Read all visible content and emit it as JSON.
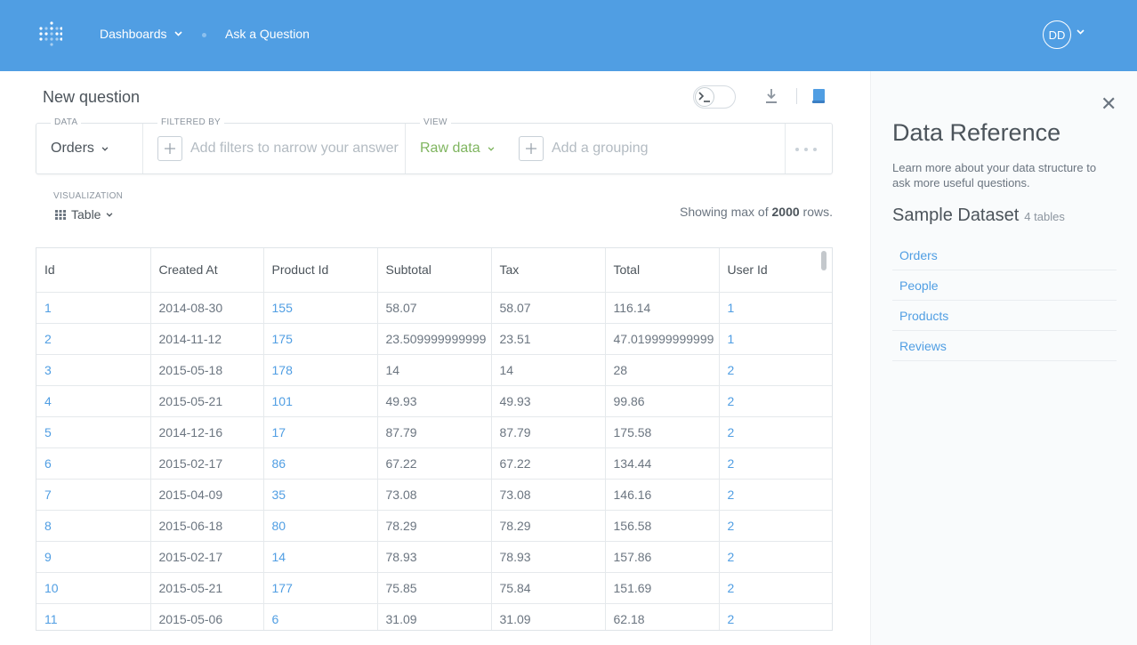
{
  "nav": {
    "dashboards_label": "Dashboards",
    "ask_label": "Ask a Question",
    "avatar_initials": "DD",
    "accent_color": "#509ee3"
  },
  "question": {
    "title": "New question"
  },
  "query_builder": {
    "data_label": "DATA",
    "data_value": "Orders",
    "filter_label": "FILTERED BY",
    "filter_placeholder": "Add filters to narrow your answer",
    "view_label": "VIEW",
    "view_value": "Raw data",
    "grouping_placeholder": "Add a grouping"
  },
  "visualization": {
    "label": "VISUALIZATION",
    "value": "Table"
  },
  "rows_note": {
    "prefix": "Showing max of",
    "count": "2000",
    "suffix": "rows."
  },
  "table": {
    "columns": [
      "Id",
      "Created At",
      "Product Id",
      "Subtotal",
      "Tax",
      "Total",
      "User Id"
    ],
    "rows": [
      [
        "1",
        "2014-08-30",
        "155",
        "58.07",
        "58.07",
        "116.14",
        "1"
      ],
      [
        "2",
        "2014-11-12",
        "175",
        "23.509999999999",
        "23.51",
        "47.019999999999",
        "1"
      ],
      [
        "3",
        "2015-05-18",
        "178",
        "14",
        "14",
        "28",
        "2"
      ],
      [
        "4",
        "2015-05-21",
        "101",
        "49.93",
        "49.93",
        "99.86",
        "2"
      ],
      [
        "5",
        "2014-12-16",
        "17",
        "87.79",
        "87.79",
        "175.58",
        "2"
      ],
      [
        "6",
        "2015-02-17",
        "86",
        "67.22",
        "67.22",
        "134.44",
        "2"
      ],
      [
        "7",
        "2015-04-09",
        "35",
        "73.08",
        "73.08",
        "146.16",
        "2"
      ],
      [
        "8",
        "2015-06-18",
        "80",
        "78.29",
        "78.29",
        "156.58",
        "2"
      ],
      [
        "9",
        "2015-02-17",
        "14",
        "78.93",
        "78.93",
        "157.86",
        "2"
      ],
      [
        "10",
        "2015-05-21",
        "177",
        "75.85",
        "75.84",
        "151.69",
        "2"
      ],
      [
        "11",
        "2015-05-06",
        "6",
        "31.09",
        "31.09",
        "62.18",
        "2"
      ]
    ]
  },
  "side_panel": {
    "title": "Data Reference",
    "description": "Learn more about your data structure to ask more useful questions.",
    "dataset_name": "Sample Dataset",
    "dataset_count": "4 tables",
    "tables": [
      "Orders",
      "People",
      "Products",
      "Reviews"
    ]
  }
}
